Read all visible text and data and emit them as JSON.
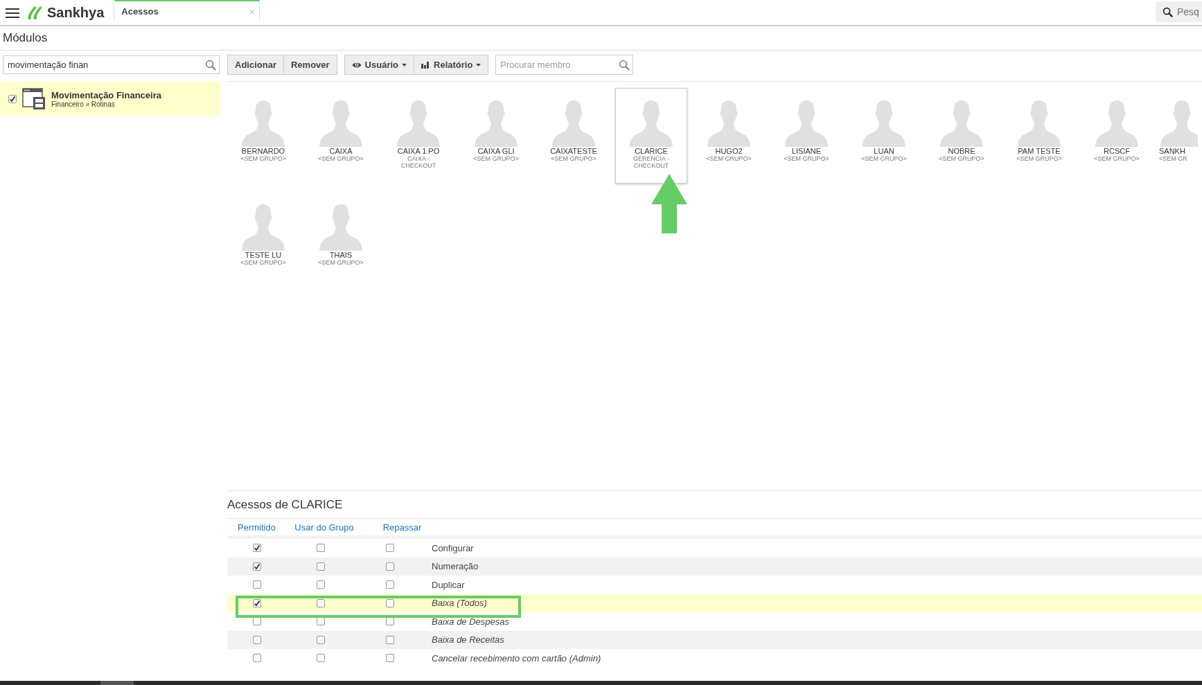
{
  "header": {
    "logo": "Sankhya",
    "tab": {
      "label": "Acessos",
      "close": "×"
    },
    "search": {
      "placeholder": "Pesq"
    }
  },
  "title": "Módulos",
  "module_search": {
    "value": "movimentação finan"
  },
  "modules": [
    {
      "name": "Movimentação Financeira",
      "path": "Financeiro » Rotinas",
      "checked": true,
      "selected": true
    }
  ],
  "toolbar": {
    "buttons": [
      "Adicionar",
      "Remover"
    ],
    "menus": [
      {
        "label": "Usuário",
        "kind": "eye"
      },
      {
        "label": "Relatório",
        "kind": "chart"
      }
    ],
    "member_search": {
      "placeholder": "Procurar membro"
    }
  },
  "members": [
    {
      "name": "BERNARDO",
      "group": "<SEM GRUPO>",
      "selected": false
    },
    {
      "name": "CAIXA",
      "group": "<SEM GRUPO>",
      "selected": false
    },
    {
      "name": "CAIXA 1 PO",
      "group": "CAIXA - CHECKOUT",
      "selected": false
    },
    {
      "name": "CAIXA GLI",
      "group": "<SEM GRUPO>",
      "selected": false
    },
    {
      "name": "CAIXATESTE",
      "group": "<SEM GRUPO>",
      "selected": false
    },
    {
      "name": "CLARICE",
      "group": "GERENCIA - CHECKOUT",
      "selected": true
    },
    {
      "name": "HUGO2",
      "group": "<SEM GRUPO>",
      "selected": false
    },
    {
      "name": "LISIANE",
      "group": "<SEM GRUPO>",
      "selected": false
    },
    {
      "name": "LUAN",
      "group": "<SEM GRUPO>",
      "selected": false
    },
    {
      "name": "NOBRE",
      "group": "<SEM GRUPO>",
      "selected": false
    },
    {
      "name": "PAM TESTE",
      "group": "<SEM GRUPO>",
      "selected": false
    },
    {
      "name": "RCSCF",
      "group": "<SEM GRUPO>",
      "selected": false
    },
    {
      "name": "SANKH",
      "group": "<SEM GR",
      "selected": false
    },
    {
      "name": "TESTE LU",
      "group": "<SEM GRUPO>",
      "selected": false
    },
    {
      "name": "THAIS",
      "group": "<SEM GRUPO>",
      "selected": false
    }
  ],
  "access": {
    "title": "Acessos de CLARICE",
    "columns": [
      "Permitido",
      "Usar do Grupo",
      "Repassar"
    ],
    "rows": [
      {
        "label": "Configurar",
        "permitido": true,
        "usar_do_grupo": false,
        "repassar": false,
        "italic": false,
        "highlighted": false
      },
      {
        "label": "Numeração",
        "permitido": true,
        "usar_do_grupo": false,
        "repassar": false,
        "italic": false,
        "highlighted": false
      },
      {
        "label": "Duplicar",
        "permitido": false,
        "usar_do_grupo": false,
        "repassar": false,
        "italic": false,
        "highlighted": false
      },
      {
        "label": "Baixa (Todos)",
        "permitido": true,
        "usar_do_grupo": false,
        "repassar": false,
        "italic": true,
        "highlighted": true
      },
      {
        "label": "Baixa de Despesas",
        "permitido": false,
        "usar_do_grupo": false,
        "repassar": false,
        "italic": true,
        "highlighted": false
      },
      {
        "label": "Baixa de Receitas",
        "permitido": false,
        "usar_do_grupo": false,
        "repassar": false,
        "italic": true,
        "highlighted": false
      },
      {
        "label": "Cancelar recebimento com cartão (Admin)",
        "permitido": false,
        "usar_do_grupo": false,
        "repassar": false,
        "italic": true,
        "highlighted": false
      }
    ]
  }
}
